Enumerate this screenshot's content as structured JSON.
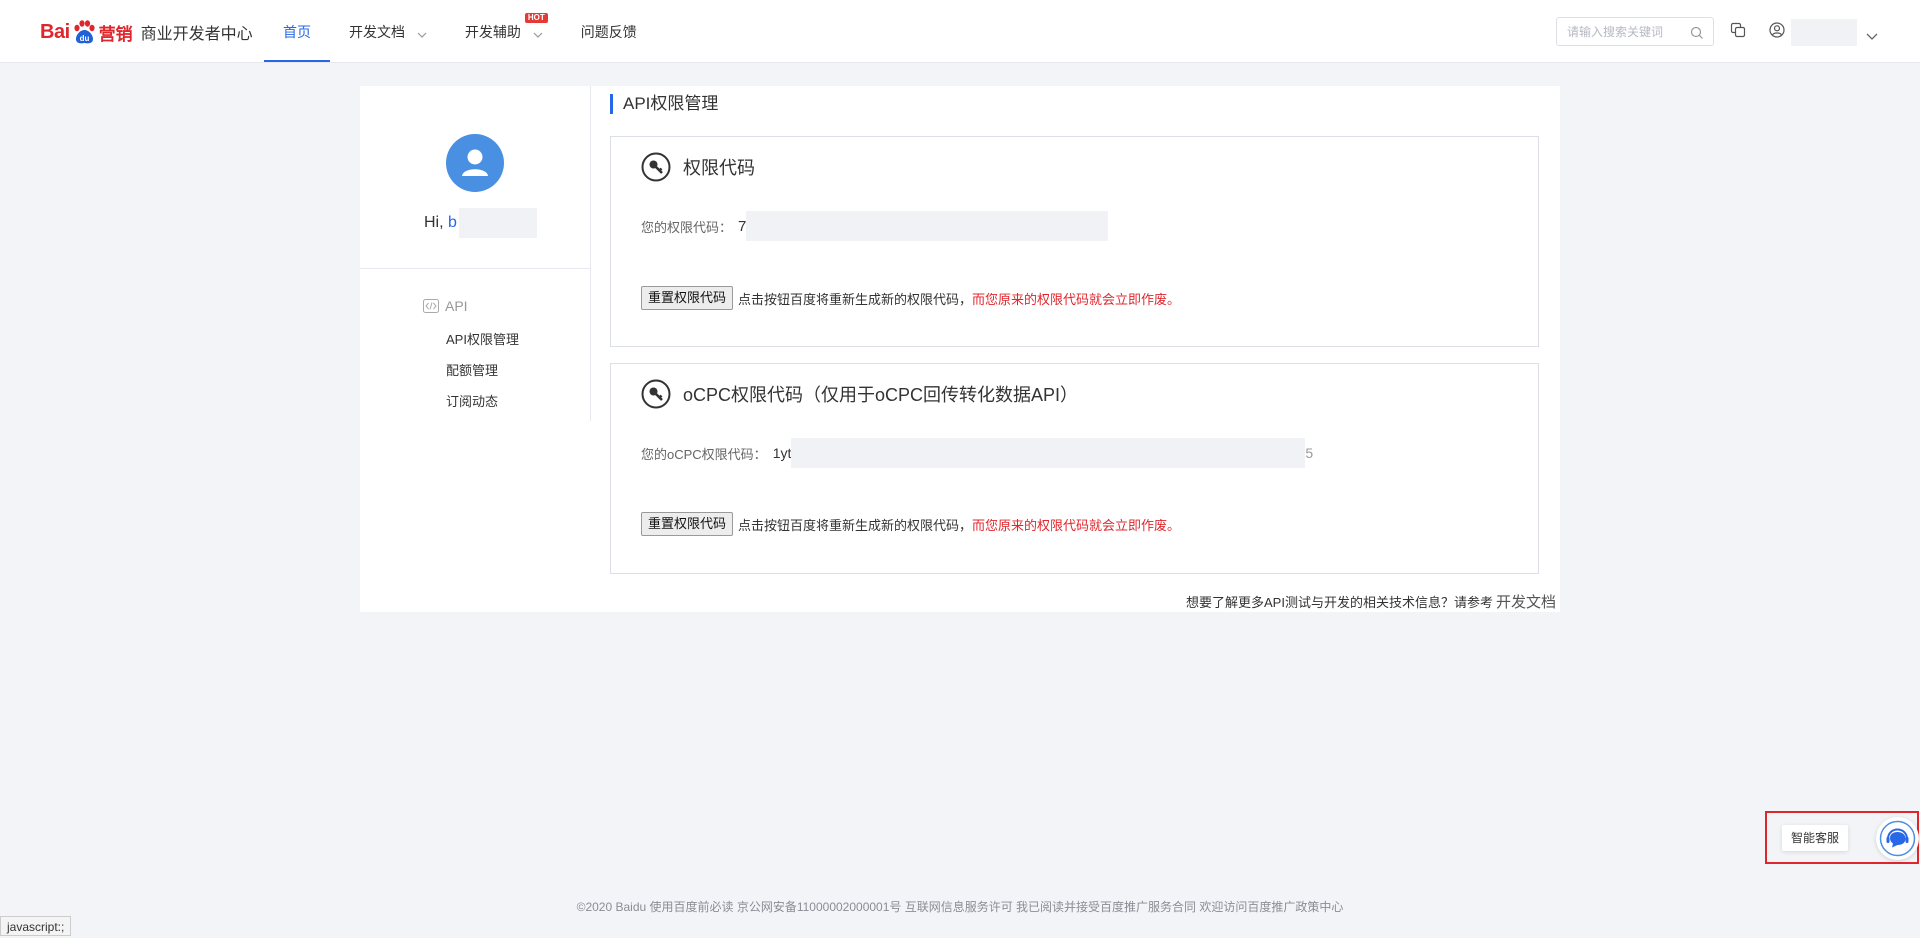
{
  "header": {
    "logo": {
      "brand_left": "Bai",
      "brand_right": "营销",
      "subtitle": "商业开发者中心"
    },
    "nav": [
      {
        "label": "首页",
        "active": true,
        "dropdown": false,
        "hot": false
      },
      {
        "label": "开发文档",
        "active": false,
        "dropdown": true,
        "hot": false
      },
      {
        "label": "开发辅助",
        "active": false,
        "dropdown": true,
        "hot": true
      },
      {
        "label": "问题反馈",
        "active": false,
        "dropdown": false,
        "hot": false
      }
    ],
    "hot_badge": "HOT",
    "search": {
      "placeholder": "请输入搜索关键词"
    },
    "icons": [
      "copy-icon",
      "user-icon",
      "chevron-down-icon"
    ]
  },
  "sidebar": {
    "greeting": "Hi,",
    "username_visible": "b",
    "group": "API",
    "items": [
      "API权限管理",
      "配额管理",
      "订阅动态"
    ]
  },
  "content": {
    "title": "API权限管理",
    "cards": [
      {
        "title": "权限代码",
        "code_label": "您的权限代码：",
        "code_visible": "7",
        "button": "重置权限代码",
        "note": "点击按钮百度将重新生成新的权限代码，",
        "warning": "而您原来的权限代码就会立即作废。"
      },
      {
        "title": "oCPC权限代码（仅用于oCPC回传转化数据API）",
        "code_label": "您的oCPC权限代码：",
        "code_visible": "1yt",
        "code_visible_end": "5",
        "button": "重置权限代码",
        "note": "点击按钮百度将重新生成新的权限代码，",
        "warning": "而您原来的权限代码就会立即作废。"
      }
    ],
    "more_info": "想要了解更多API测试与开发的相关技术信息？请参考",
    "more_link": "开发文档"
  },
  "footer": {
    "text": "©2020 Baidu 使用百度前必读 京公网安备11000002000001号 互联网信息服务许可 我已阅读并接受百度推广服务合同 欢迎访问百度推广政策中心"
  },
  "chat_widget": {
    "label": "智能客服"
  },
  "status_bar": "javascript:;",
  "colors": {
    "accent": "#2867e8",
    "brand_red": "#e0262d",
    "page_bg": "#f3f4f7"
  }
}
